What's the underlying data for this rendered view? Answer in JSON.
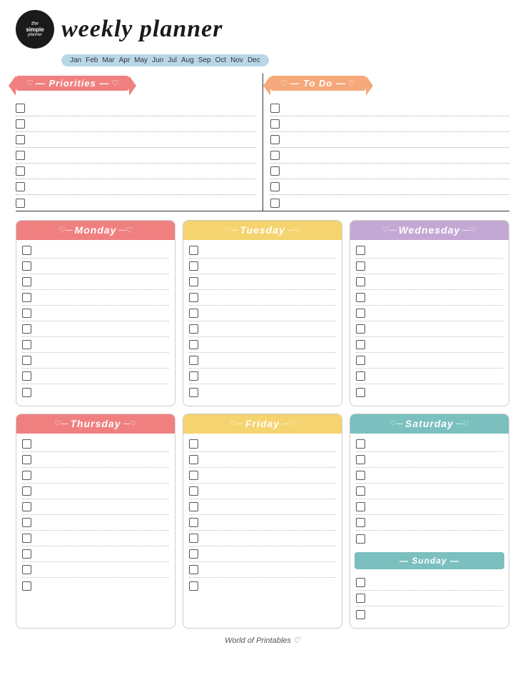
{
  "header": {
    "logo_line1": "the",
    "logo_line2": "simple",
    "logo_line3": "planner",
    "title": "weekly planner"
  },
  "months": [
    "Jan",
    "Feb",
    "Mar",
    "Apr",
    "May",
    "Jun",
    "Jul",
    "Aug",
    "Sep",
    "Oct",
    "Nov",
    "Dec"
  ],
  "priorities": {
    "label": "— Priorities —",
    "rows": 7
  },
  "todo": {
    "label": "— To Do —",
    "rows": 7
  },
  "days": [
    {
      "label": "Monday",
      "color": "pink-bg",
      "rows": 10
    },
    {
      "label": "Tuesday",
      "color": "yellow-bg",
      "rows": 10
    },
    {
      "label": "Wednesday",
      "color": "lavender-bg",
      "rows": 10
    },
    {
      "label": "Thursday",
      "color": "coral-bg",
      "rows": 10
    },
    {
      "label": "Friday",
      "color": "cream-bg",
      "rows": 10
    },
    {
      "label": "Saturday",
      "color": "teal-bg",
      "rows": 10,
      "has_sunday": true,
      "sunday_label": "Sunday"
    }
  ],
  "footer": {
    "text": "World of Printables ♡"
  },
  "colors": {
    "pink": "#f08080",
    "yellow": "#f5d36e",
    "lavender": "#c4a8d4",
    "teal": "#7bbfbf",
    "orange": "#f5a87a"
  }
}
